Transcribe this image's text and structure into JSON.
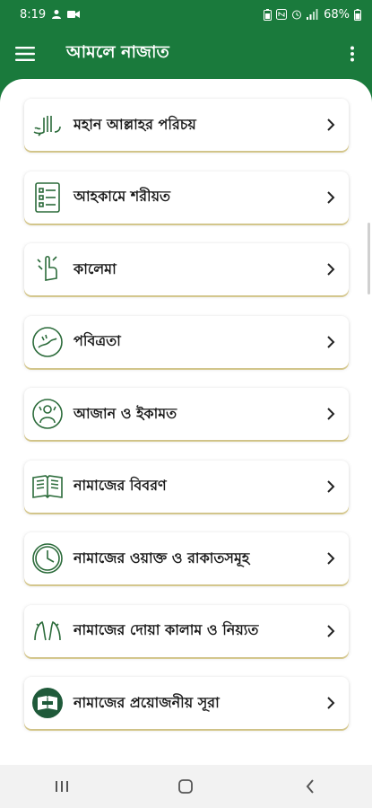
{
  "status_bar": {
    "time": "8:19",
    "battery": "68%"
  },
  "app_bar": {
    "title": "আমলে নাজাত",
    "menu_icon": "hamburger-icon",
    "more_icon": "more-vert-icon"
  },
  "menu": {
    "items": [
      {
        "label": "মহান আল্লাহর পরিচয়",
        "icon": "allah-calligraphy-icon"
      },
      {
        "label": "আহকামে শরীয়ত",
        "icon": "checklist-icon"
      },
      {
        "label": "কালেমা",
        "icon": "raised-finger-icon"
      },
      {
        "label": "পবিত্রতা",
        "icon": "ablution-icon"
      },
      {
        "label": "আজান ও ইকামত",
        "icon": "muezzin-icon"
      },
      {
        "label": "নামাজের বিবরণ",
        "icon": "open-book-icon"
      },
      {
        "label": "নামাজের ওয়াক্ত ও রাকাতসমূহ",
        "icon": "clock-icon"
      },
      {
        "label": "নামাজের দোয়া কালাম ও নিয়্যত",
        "icon": "praying-hands-icon"
      },
      {
        "label": "নামাজের প্রয়োজনীয় সূরা",
        "icon": "quran-icon"
      }
    ]
  },
  "colors": {
    "primary": "#1a7a3c",
    "accent_underline": "#d6ba46",
    "icon_stroke": "#2b6b3a"
  }
}
